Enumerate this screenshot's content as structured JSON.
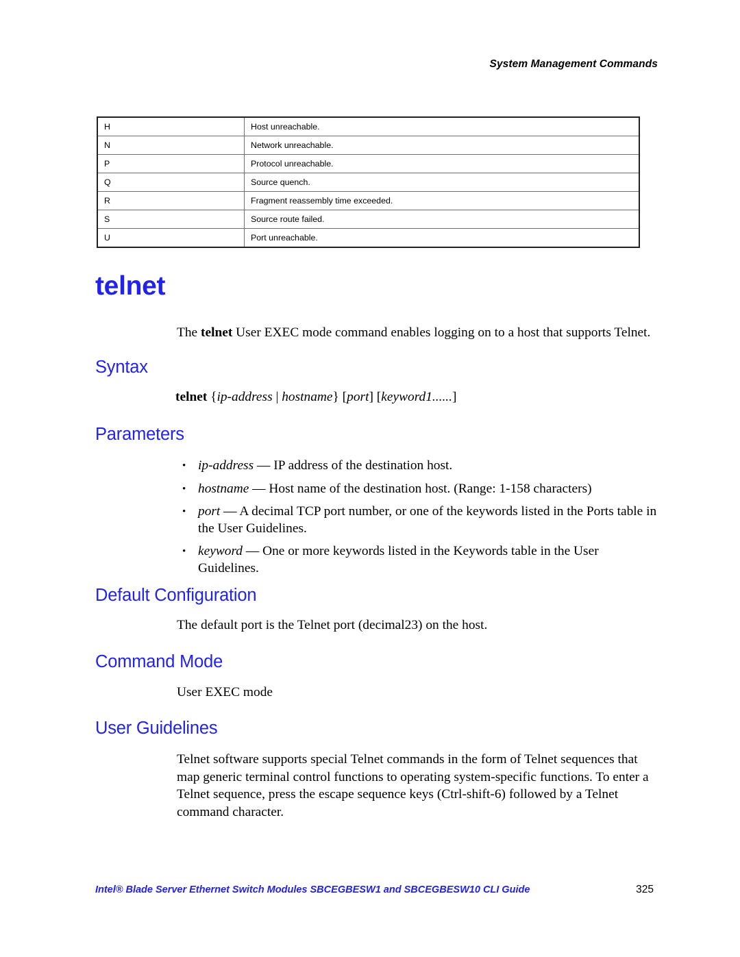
{
  "header": {
    "running_title": "System Management Commands"
  },
  "icmp_table": {
    "rows": [
      {
        "code": "H",
        "description": "Host unreachable."
      },
      {
        "code": "N",
        "description": "Network unreachable."
      },
      {
        "code": "P",
        "description": "Protocol unreachable."
      },
      {
        "code": "Q",
        "description": "Source quench."
      },
      {
        "code": "R",
        "description": "Fragment reassembly time exceeded."
      },
      {
        "code": "S",
        "description": "Source route failed."
      },
      {
        "code": "U",
        "description": "Port unreachable."
      }
    ]
  },
  "command": {
    "title": "telnet",
    "intro": {
      "before": "The ",
      "bold": "telnet",
      "after": " User EXEC mode command enables logging on to a host that supports Telnet."
    }
  },
  "sections": {
    "syntax": {
      "heading": "Syntax",
      "command_name": "telnet",
      "open_brace": " {",
      "arg_ip": "ip-address",
      "pipe": " | ",
      "arg_host": "hostname",
      "close_brace": "} [",
      "arg_port": "port",
      "mid_bracket": "] [",
      "arg_keyword": "keyword1......",
      "close_bracket": "]"
    },
    "parameters": {
      "heading": "Parameters",
      "items": [
        {
          "term": "ip-address",
          "dash": " — ",
          "desc": "IP address of the destination host."
        },
        {
          "term": "hostname",
          "dash": " — ",
          "desc": "Host name of the destination host. (Range: 1-158 characters)"
        },
        {
          "term": "port",
          "dash": " — ",
          "desc": "A decimal TCP port number, or one of the keywords listed in the Ports table in the User Guidelines."
        },
        {
          "term": "keyword",
          "dash": " — ",
          "desc": "One or more keywords listed in the Keywords table in the User Guidelines."
        }
      ]
    },
    "default_configuration": {
      "heading": "Default Configuration",
      "text": "The default port is the Telnet port (decimal23) on the host."
    },
    "command_mode": {
      "heading": "Command Mode",
      "text": "User EXEC mode"
    },
    "user_guidelines": {
      "heading": "User Guidelines",
      "text": "Telnet software supports special Telnet commands in the form of Telnet sequences that map generic terminal control functions to operating system-specific functions. To enter a Telnet sequence, press the escape sequence keys (Ctrl-shift-6) followed by a Telnet command character."
    }
  },
  "footer": {
    "title": "Intel® Blade Server Ethernet Switch Modules SBCEGBESW1 and SBCEGBESW10 CLI Guide",
    "page_number": "325"
  },
  "colors": {
    "heading_blue": "#2222ee",
    "text_black": "#000000",
    "table_border": "#231f20",
    "table_rule": "#6e6e6e"
  }
}
